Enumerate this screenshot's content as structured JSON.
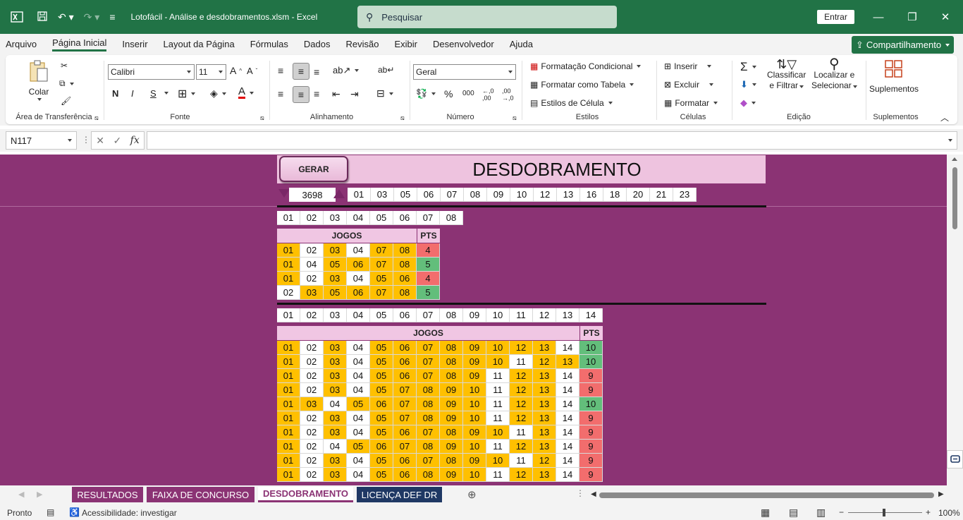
{
  "window": {
    "title": "Lotofácil - Análise e desdobramentos.xlsm  -  Excel",
    "search_placeholder": "Pesquisar",
    "signin": "Entrar"
  },
  "menu": {
    "tabs": [
      "Arquivo",
      "Página Inicial",
      "Inserir",
      "Layout da Página",
      "Fórmulas",
      "Dados",
      "Revisão",
      "Exibir",
      "Desenvolvedor",
      "Ajuda"
    ],
    "active": "Página Inicial",
    "share": "Compartilhamento"
  },
  "ribbon": {
    "clipboard": {
      "paste": "Colar",
      "label": "Área de Transferência"
    },
    "font": {
      "name": "Calibri",
      "size": "11",
      "bold": "N",
      "italic": "I",
      "underline": "S",
      "label": "Fonte"
    },
    "alignment": {
      "label": "Alinhamento"
    },
    "number": {
      "format": "Geral",
      "label": "Número"
    },
    "styles": {
      "conditional": "Formatação Condicional",
      "as_table": "Formatar como Tabela",
      "cell_styles": "Estilos de Célula",
      "label": "Estilos"
    },
    "cells": {
      "insert": "Inserir",
      "delete": "Excluir",
      "format": "Formatar",
      "label": "Células"
    },
    "editing": {
      "sort_line1": "Classificar",
      "sort_line2": "e Filtrar",
      "find_line1": "Localizar e",
      "find_line2": "Selecionar",
      "label": "Edição"
    },
    "addins": {
      "button": "Suplementos",
      "label": "Suplementos"
    }
  },
  "formula_bar": {
    "name_box": "N117",
    "fx": "fx",
    "content": ""
  },
  "sheet": {
    "button": "GERAR",
    "title": "DESDOBRAMENTO",
    "count": "3698",
    "top_numbers": [
      "01",
      "03",
      "05",
      "06",
      "07",
      "08",
      "09",
      "10",
      "12",
      "13",
      "16",
      "18",
      "20",
      "21",
      "23"
    ],
    "small": {
      "numbers": [
        "01",
        "02",
        "03",
        "04",
        "05",
        "06",
        "07",
        "08"
      ],
      "jogos_label": "JOGOS",
      "pts_label": "PTS",
      "rows": [
        {
          "cells": [
            [
              "01",
              "y"
            ],
            [
              "02",
              "w"
            ],
            [
              "03",
              "y"
            ],
            [
              "04",
              "w"
            ],
            [
              "07",
              "y"
            ],
            [
              "08",
              "y"
            ]
          ],
          "pts": "4",
          "pts_color": "red"
        },
        {
          "cells": [
            [
              "01",
              "y"
            ],
            [
              "04",
              "w"
            ],
            [
              "05",
              "y"
            ],
            [
              "06",
              "y"
            ],
            [
              "07",
              "y"
            ],
            [
              "08",
              "y"
            ]
          ],
          "pts": "5",
          "pts_color": "green"
        },
        {
          "cells": [
            [
              "01",
              "y"
            ],
            [
              "02",
              "w"
            ],
            [
              "03",
              "y"
            ],
            [
              "04",
              "w"
            ],
            [
              "05",
              "y"
            ],
            [
              "06",
              "y"
            ]
          ],
          "pts": "4",
          "pts_color": "red"
        },
        {
          "cells": [
            [
              "02",
              "w"
            ],
            [
              "03",
              "y"
            ],
            [
              "05",
              "y"
            ],
            [
              "06",
              "y"
            ],
            [
              "07",
              "y"
            ],
            [
              "08",
              "y"
            ]
          ],
          "pts": "5",
          "pts_color": "green"
        }
      ]
    },
    "large": {
      "numbers": [
        "01",
        "02",
        "03",
        "04",
        "05",
        "06",
        "07",
        "08",
        "09",
        "10",
        "11",
        "12",
        "13",
        "14"
      ],
      "jogos_label": "JOGOS",
      "pts_label": "PTS",
      "rows": [
        {
          "cells": [
            [
              "01",
              "y"
            ],
            [
              "02",
              "w"
            ],
            [
              "03",
              "y"
            ],
            [
              "04",
              "w"
            ],
            [
              "05",
              "y"
            ],
            [
              "06",
              "y"
            ],
            [
              "07",
              "y"
            ],
            [
              "08",
              "y"
            ],
            [
              "09",
              "y"
            ],
            [
              "10",
              "y"
            ],
            [
              "12",
              "y"
            ],
            [
              "13",
              "y"
            ],
            [
              "14",
              "w"
            ]
          ],
          "pts": "10",
          "pts_color": "green"
        },
        {
          "cells": [
            [
              "01",
              "y"
            ],
            [
              "02",
              "w"
            ],
            [
              "03",
              "y"
            ],
            [
              "04",
              "w"
            ],
            [
              "05",
              "y"
            ],
            [
              "06",
              "y"
            ],
            [
              "07",
              "y"
            ],
            [
              "08",
              "y"
            ],
            [
              "09",
              "y"
            ],
            [
              "10",
              "y"
            ],
            [
              "11",
              "w"
            ],
            [
              "12",
              "y"
            ],
            [
              "13",
              "y"
            ]
          ],
          "pts": "10",
          "pts_color": "green"
        },
        {
          "cells": [
            [
              "01",
              "y"
            ],
            [
              "02",
              "w"
            ],
            [
              "03",
              "y"
            ],
            [
              "04",
              "w"
            ],
            [
              "05",
              "y"
            ],
            [
              "06",
              "y"
            ],
            [
              "07",
              "y"
            ],
            [
              "08",
              "y"
            ],
            [
              "09",
              "y"
            ],
            [
              "11",
              "w"
            ],
            [
              "12",
              "y"
            ],
            [
              "13",
              "y"
            ],
            [
              "14",
              "w"
            ]
          ],
          "pts": "9",
          "pts_color": "red"
        },
        {
          "cells": [
            [
              "01",
              "y"
            ],
            [
              "02",
              "w"
            ],
            [
              "03",
              "y"
            ],
            [
              "04",
              "w"
            ],
            [
              "05",
              "y"
            ],
            [
              "07",
              "y"
            ],
            [
              "08",
              "y"
            ],
            [
              "09",
              "y"
            ],
            [
              "10",
              "y"
            ],
            [
              "11",
              "w"
            ],
            [
              "12",
              "y"
            ],
            [
              "13",
              "y"
            ],
            [
              "14",
              "w"
            ]
          ],
          "pts": "9",
          "pts_color": "red"
        },
        {
          "cells": [
            [
              "01",
              "y"
            ],
            [
              "03",
              "y"
            ],
            [
              "04",
              "w"
            ],
            [
              "05",
              "y"
            ],
            [
              "06",
              "y"
            ],
            [
              "07",
              "y"
            ],
            [
              "08",
              "y"
            ],
            [
              "09",
              "y"
            ],
            [
              "10",
              "y"
            ],
            [
              "11",
              "w"
            ],
            [
              "12",
              "y"
            ],
            [
              "13",
              "y"
            ],
            [
              "14",
              "w"
            ]
          ],
          "pts": "10",
          "pts_color": "green"
        },
        {
          "cells": [
            [
              "01",
              "y"
            ],
            [
              "02",
              "w"
            ],
            [
              "03",
              "y"
            ],
            [
              "04",
              "w"
            ],
            [
              "05",
              "y"
            ],
            [
              "07",
              "y"
            ],
            [
              "08",
              "y"
            ],
            [
              "09",
              "y"
            ],
            [
              "10",
              "y"
            ],
            [
              "11",
              "w"
            ],
            [
              "12",
              "y"
            ],
            [
              "13",
              "y"
            ],
            [
              "14",
              "w"
            ]
          ],
          "pts": "9",
          "pts_color": "red"
        },
        {
          "cells": [
            [
              "01",
              "y"
            ],
            [
              "02",
              "w"
            ],
            [
              "03",
              "y"
            ],
            [
              "04",
              "w"
            ],
            [
              "05",
              "y"
            ],
            [
              "06",
              "y"
            ],
            [
              "07",
              "y"
            ],
            [
              "08",
              "y"
            ],
            [
              "09",
              "y"
            ],
            [
              "10",
              "y"
            ],
            [
              "11",
              "w"
            ],
            [
              "13",
              "y"
            ],
            [
              "14",
              "w"
            ]
          ],
          "pts": "9",
          "pts_color": "red"
        },
        {
          "cells": [
            [
              "01",
              "y"
            ],
            [
              "02",
              "w"
            ],
            [
              "04",
              "w"
            ],
            [
              "05",
              "y"
            ],
            [
              "06",
              "y"
            ],
            [
              "07",
              "y"
            ],
            [
              "08",
              "y"
            ],
            [
              "09",
              "y"
            ],
            [
              "10",
              "y"
            ],
            [
              "11",
              "w"
            ],
            [
              "12",
              "y"
            ],
            [
              "13",
              "y"
            ],
            [
              "14",
              "w"
            ]
          ],
          "pts": "9",
          "pts_color": "red"
        },
        {
          "cells": [
            [
              "01",
              "y"
            ],
            [
              "02",
              "w"
            ],
            [
              "03",
              "y"
            ],
            [
              "04",
              "w"
            ],
            [
              "05",
              "y"
            ],
            [
              "06",
              "y"
            ],
            [
              "07",
              "y"
            ],
            [
              "08",
              "y"
            ],
            [
              "09",
              "y"
            ],
            [
              "10",
              "y"
            ],
            [
              "11",
              "w"
            ],
            [
              "12",
              "y"
            ],
            [
              "14",
              "w"
            ]
          ],
          "pts": "9",
          "pts_color": "red"
        },
        {
          "cells": [
            [
              "01",
              "y"
            ],
            [
              "02",
              "w"
            ],
            [
              "03",
              "y"
            ],
            [
              "04",
              "w"
            ],
            [
              "05",
              "y"
            ],
            [
              "06",
              "y"
            ],
            [
              "08",
              "y"
            ],
            [
              "09",
              "y"
            ],
            [
              "10",
              "y"
            ],
            [
              "11",
              "w"
            ],
            [
              "12",
              "y"
            ],
            [
              "13",
              "y"
            ],
            [
              "14",
              "w"
            ]
          ],
          "pts": "9",
          "pts_color": "red"
        }
      ]
    }
  },
  "sheet_tabs": [
    {
      "label": "RESULTADOS",
      "color": "#8b3374",
      "active": false
    },
    {
      "label": "FAIXA DE CONCURSO",
      "color": "#8b3374",
      "active": false
    },
    {
      "label": "DESDOBRAMENTO",
      "color": "#8b3374",
      "active": true
    },
    {
      "label": "LICENÇA DEF DR",
      "color": "#1f3864",
      "active": false
    }
  ],
  "status": {
    "ready": "Pronto",
    "accessibility": "Acessibilidade: investigar",
    "zoom": "100%"
  },
  "colors": {
    "excel_green": "#217346",
    "sheet_bg": "#8b3374",
    "yellow": "#ffc000",
    "pink_header": "#eec3df",
    "red_pts": "#f26d6d",
    "green_pts": "#63be7b"
  }
}
